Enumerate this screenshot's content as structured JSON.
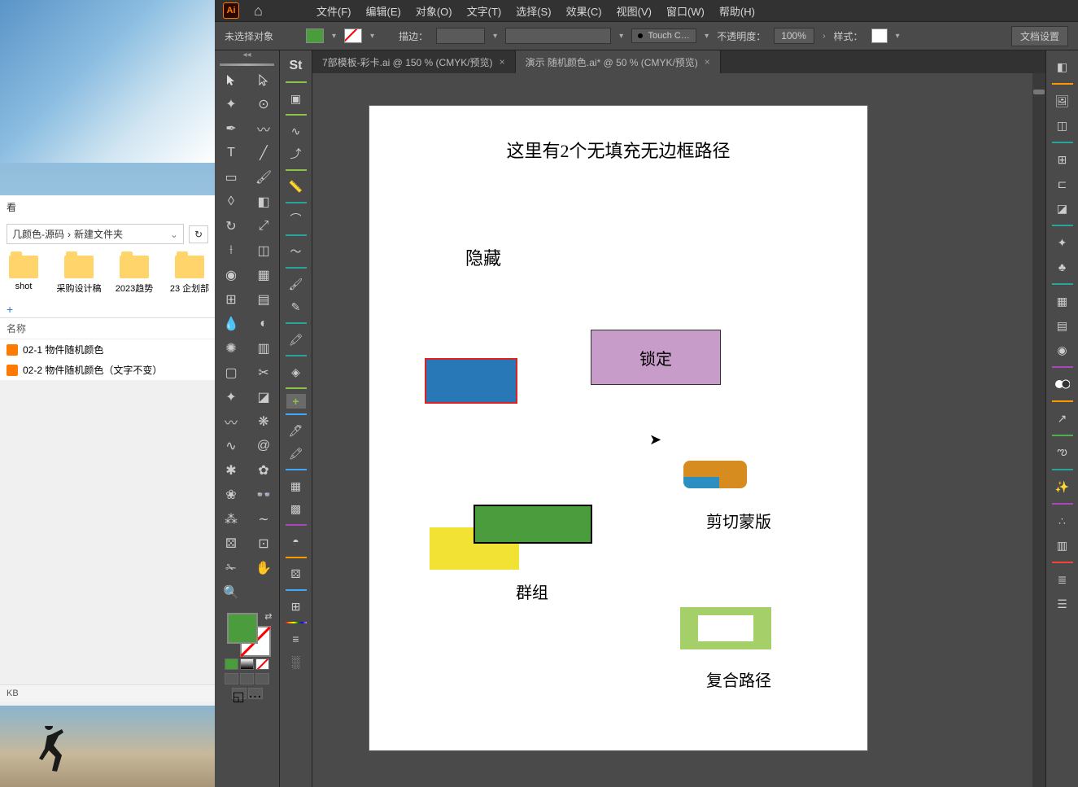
{
  "explorer": {
    "view_label": "看",
    "path_part1": "几颜色-源码",
    "path_sep": "›",
    "path_part2": "新建文件夹",
    "folders": [
      "shot",
      "采购设计稿",
      "2023趋势",
      "23 企划部"
    ],
    "col_name": "名称",
    "files": [
      "02-1 物件随机颜色",
      "02-2 物件随机颜色（文字不变）"
    ],
    "status": "KB"
  },
  "menu": {
    "file": "文件(F)",
    "edit": "编辑(E)",
    "object": "对象(O)",
    "type": "文字(T)",
    "select": "选择(S)",
    "effect": "效果(C)",
    "view": "视图(V)",
    "window": "窗口(W)",
    "help": "帮助(H)"
  },
  "control": {
    "no_selection": "未选择对象",
    "stroke_label": "描边：",
    "brush_name": "Touch C…",
    "opacity_label": "不透明度：",
    "opacity_value": "100%",
    "style_label": "样式：",
    "doc_setup": "文档设置"
  },
  "tabs": {
    "tab1": "7部模板-彩卡.ai @ 150 % (CMYK/预览)",
    "tab2": "演示  随机颜色.ai* @ 50 % (CMYK/预览)"
  },
  "artboard": {
    "title": "这里有2个无填充无边框路径",
    "hidden": "隐藏",
    "locked": "锁定",
    "group": "群组",
    "clip": "剪切蒙版",
    "compound": "复合路径"
  },
  "colors": {
    "fill": "#4a9c3c",
    "blue": "#2878b8",
    "purple": "#c89cc8",
    "yellow": "#f2e233",
    "orange": "#d68c1e",
    "lightgreen": "#a5d069"
  }
}
